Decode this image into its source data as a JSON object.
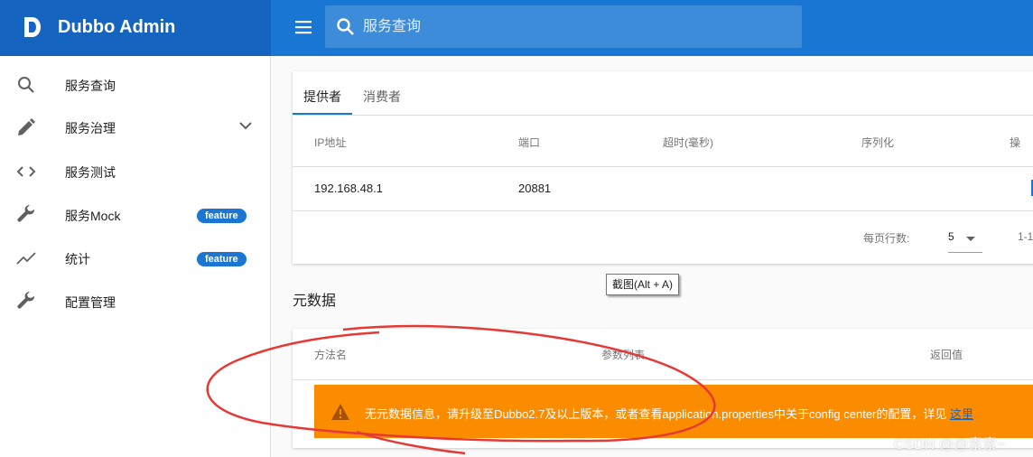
{
  "brand": {
    "title": "Dubbo Admin"
  },
  "search": {
    "placeholder": "服务查询"
  },
  "sidebar": {
    "items": [
      {
        "label": "服务查询",
        "icon": "search-icon"
      },
      {
        "label": "服务治理",
        "icon": "pencil-icon",
        "expandable": true
      },
      {
        "label": "服务测试",
        "icon": "code-icon"
      },
      {
        "label": "服务Mock",
        "icon": "wrench-icon",
        "badge": "feature"
      },
      {
        "label": "统计",
        "icon": "trend-icon",
        "badge": "feature"
      },
      {
        "label": "配置管理",
        "icon": "wrench-icon"
      }
    ]
  },
  "tabs": [
    {
      "label": "提供者",
      "active": true
    },
    {
      "label": "消费者"
    }
  ],
  "providers": {
    "columns": [
      "IP地址",
      "端口",
      "超时(毫秒)",
      "序列化",
      "操"
    ],
    "rows": [
      {
        "ip": "192.168.48.1",
        "port": "20881"
      }
    ],
    "pagination": {
      "label": "每页行数:",
      "per_page": "5",
      "range": "1-1"
    }
  },
  "tooltip": "截图(Alt + A)",
  "metadata": {
    "title": "元数据",
    "columns": [
      "方法名",
      "参数列表",
      "返回值"
    ],
    "alert": {
      "message": "无元数据信息，请升级至Dubbo2.7及以上版本，或者查看application.properties中关于config center的配置，详见",
      "link": "这里"
    }
  },
  "watermark": "CSDN @@素素~",
  "colors": {
    "primary": "#1976d2",
    "brand": "#1565c0",
    "warning": "#fb8c00",
    "annotation": "#e53935"
  }
}
